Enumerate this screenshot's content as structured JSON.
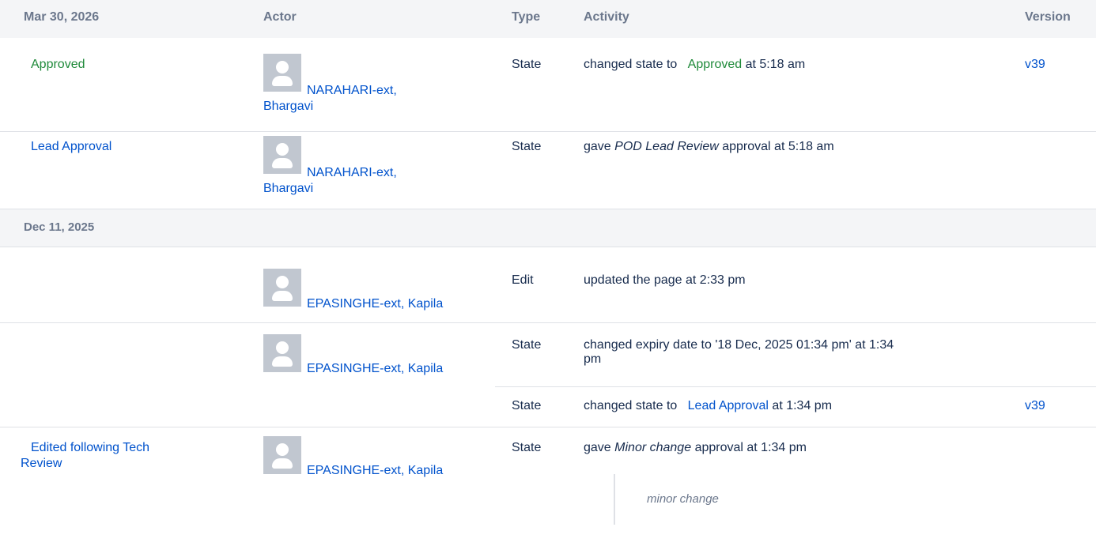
{
  "headers": {
    "date": "Mar 30, 2026",
    "actor": "Actor",
    "type": "Type",
    "activity": "Activity",
    "version": "Version"
  },
  "rows": [
    {
      "state": "Approved",
      "actor_line1": "NARAHARI-ext,",
      "actor_line2": "Bhargavi",
      "type": "State",
      "activity_pre": "changed state to",
      "activity_state": "Approved",
      "activity_post": "at 5:18 am",
      "version": "v39"
    },
    {
      "state": "Lead Approval",
      "actor_line1": "NARAHARI-ext,",
      "actor_line2": "Bhargavi",
      "type": "State",
      "activity_pre": "gave",
      "activity_em": "POD Lead Review",
      "activity_post": "approval at 5:18 am"
    }
  ],
  "date_group_2": "Dec 11, 2025",
  "rows2": [
    {
      "actor": "EPASINGHE-ext, Kapila",
      "type": "Edit",
      "activity": "updated the page at 2:33 pm"
    },
    {
      "actor": "EPASINGHE-ext, Kapila",
      "type": "State",
      "activity_line1": "changed expiry date to '18 Dec, 2025 01:34 pm' at 1:34",
      "activity_line2": "pm",
      "sub": {
        "type": "State",
        "activity_pre": "changed state to",
        "activity_state": "Lead Approval",
        "activity_post": "at 1:34 pm",
        "version": "v39"
      }
    },
    {
      "state_line1": "Edited following Tech",
      "state_line2": "Review",
      "actor": "EPASINGHE-ext, Kapila",
      "type": "State",
      "activity_pre": "gave",
      "activity_em": "Minor change",
      "activity_post": "approval at 1:34 pm",
      "comment": "minor change"
    }
  ],
  "colors": {
    "link": "#0052cc",
    "approved_green": "#1f8a3a",
    "header_bg": "#f4f5f7"
  }
}
